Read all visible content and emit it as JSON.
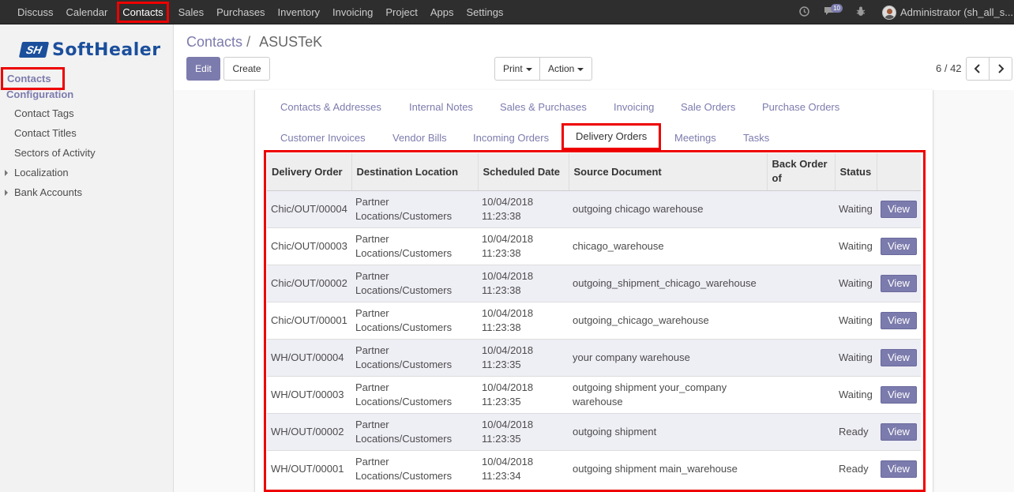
{
  "topbar": {
    "menu": [
      "Discuss",
      "Calendar",
      "Contacts",
      "Sales",
      "Purchases",
      "Inventory",
      "Invoicing",
      "Project",
      "Apps",
      "Settings"
    ],
    "badge_count": "10",
    "username": "Administrator (sh_all_s..."
  },
  "sidebar": {
    "logo_mark": "SH",
    "logo_text": "SoftHealer",
    "active": "Contacts",
    "section": "Configuration",
    "items": [
      "Contact Tags",
      "Contact Titles",
      "Sectors of Activity"
    ],
    "expandables": [
      "Localization",
      "Bank Accounts"
    ]
  },
  "breadcrumb": {
    "parent": "Contacts",
    "separator": "/",
    "current": "ASUSTeK"
  },
  "buttons": {
    "edit": "Edit",
    "create": "Create",
    "print": "Print",
    "action": "Action"
  },
  "pager": {
    "text": "6 / 42",
    "prev": "‹",
    "next": "›"
  },
  "tabs_row1": [
    "Contacts & Addresses",
    "Internal Notes",
    "Sales & Purchases",
    "Invoicing",
    "Sale Orders",
    "Purchase Orders"
  ],
  "tabs_row2": [
    "Customer Invoices",
    "Vendor Bills",
    "Incoming Orders",
    "Delivery Orders",
    "Meetings",
    "Tasks"
  ],
  "table": {
    "headers": [
      "Delivery Order",
      "Destination Location",
      "Scheduled Date",
      "Source Document",
      "Back Order of",
      "Status",
      ""
    ],
    "view_label": "View",
    "rows": [
      {
        "order": "Chic/OUT/00004",
        "dest1": "Partner",
        "dest2": "Locations/Customers",
        "date": "10/04/2018",
        "time": "11:23:38",
        "source": "outgoing chicago warehouse",
        "backorder": "",
        "status": "Waiting"
      },
      {
        "order": "Chic/OUT/00003",
        "dest1": "Partner",
        "dest2": "Locations/Customers",
        "date": "10/04/2018",
        "time": "11:23:38",
        "source": "chicago_warehouse",
        "backorder": "",
        "status": "Waiting"
      },
      {
        "order": "Chic/OUT/00002",
        "dest1": "Partner",
        "dest2": "Locations/Customers",
        "date": "10/04/2018",
        "time": "11:23:38",
        "source": "outgoing_shipment_chicago_warehouse",
        "backorder": "",
        "status": "Waiting"
      },
      {
        "order": "Chic/OUT/00001",
        "dest1": "Partner",
        "dest2": "Locations/Customers",
        "date": "10/04/2018",
        "time": "11:23:38",
        "source": "outgoing_chicago_warehouse",
        "backorder": "",
        "status": "Waiting"
      },
      {
        "order": "WH/OUT/00004",
        "dest1": "Partner",
        "dest2": "Locations/Customers",
        "date": "10/04/2018",
        "time": "11:23:35",
        "source": "your company warehouse",
        "backorder": "",
        "status": "Waiting"
      },
      {
        "order": "WH/OUT/00003",
        "dest1": "Partner",
        "dest2": "Locations/Customers",
        "date": "10/04/2018",
        "time": "11:23:35",
        "source": "outgoing shipment your_company warehouse",
        "backorder": "",
        "status": "Waiting"
      },
      {
        "order": "WH/OUT/00002",
        "dest1": "Partner",
        "dest2": "Locations/Customers",
        "date": "10/04/2018",
        "time": "11:23:35",
        "source": "outgoing shipment",
        "backorder": "",
        "status": "Ready"
      },
      {
        "order": "WH/OUT/00001",
        "dest1": "Partner",
        "dest2": "Locations/Customers",
        "date": "10/04/2018",
        "time": "11:23:34",
        "source": "outgoing shipment main_warehouse",
        "backorder": "",
        "status": "Ready"
      }
    ]
  },
  "colors": {
    "accent": "#7c7bad",
    "highlight": "#e00000",
    "navbar": "#2e2e2e"
  }
}
